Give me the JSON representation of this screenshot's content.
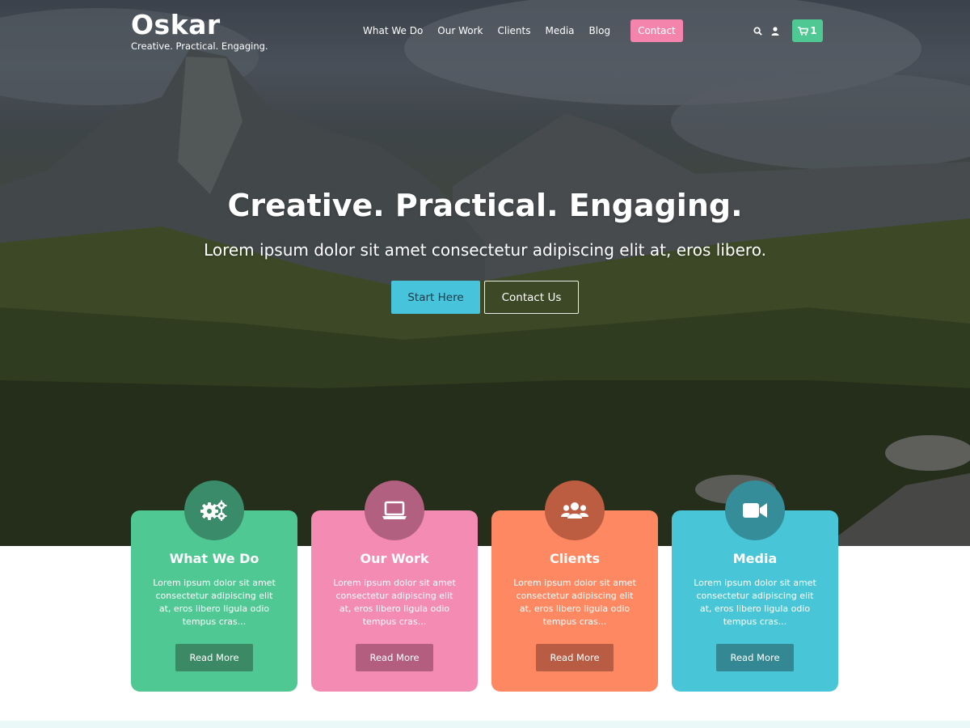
{
  "brand": {
    "name": "Oskar",
    "tagline": "Creative. Practical. Engaging."
  },
  "nav": {
    "items": [
      "What We Do",
      "Our Work",
      "Clients",
      "Media",
      "Blog"
    ],
    "contact_label": "Contact"
  },
  "tools": {
    "search_icon": "search-icon",
    "user_icon": "user-icon",
    "cart_icon": "cart-icon",
    "cart_count": "1"
  },
  "hero": {
    "title": "Creative. Practical. Engaging.",
    "subtitle": "Lorem ipsum dolor sit amet consectetur adipiscing elit at, eros libero.",
    "primary_button": "Start Here",
    "secondary_button": "Contact Us"
  },
  "cards": [
    {
      "title": "What We Do",
      "text": "Lorem ipsum dolor sit amet consectetur adipiscing elit at, eros libero ligula odio tempus cras...",
      "button": "Read More",
      "icon": "gears-icon",
      "color": "#4fc893",
      "dark": "#3a8b69",
      "btn": "#3c8966"
    },
    {
      "title": "Our Work",
      "text": "Lorem ipsum dolor sit amet consectetur adipiscing elit at, eros libero ligula odio tempus cras...",
      "button": "Read More",
      "icon": "laptop-icon",
      "color": "#f48bb2",
      "dark": "#b26080",
      "btn": "#b35e7e"
    },
    {
      "title": "Clients",
      "text": "Lorem ipsum dolor sit amet consectetur adipiscing elit at, eros libero ligula odio tempus cras...",
      "button": "Read More",
      "icon": "users-icon",
      "color": "#fe8862",
      "dark": "#bc5d42",
      "btn": "#b85d43"
    },
    {
      "title": "Media",
      "text": "Lorem ipsum dolor sit amet consectetur adipiscing elit at, eros libero ligula odio tempus cras...",
      "button": "Read More",
      "icon": "video-camera-icon",
      "color": "#49c5d8",
      "dark": "#348d98",
      "btn": "#348893"
    }
  ]
}
